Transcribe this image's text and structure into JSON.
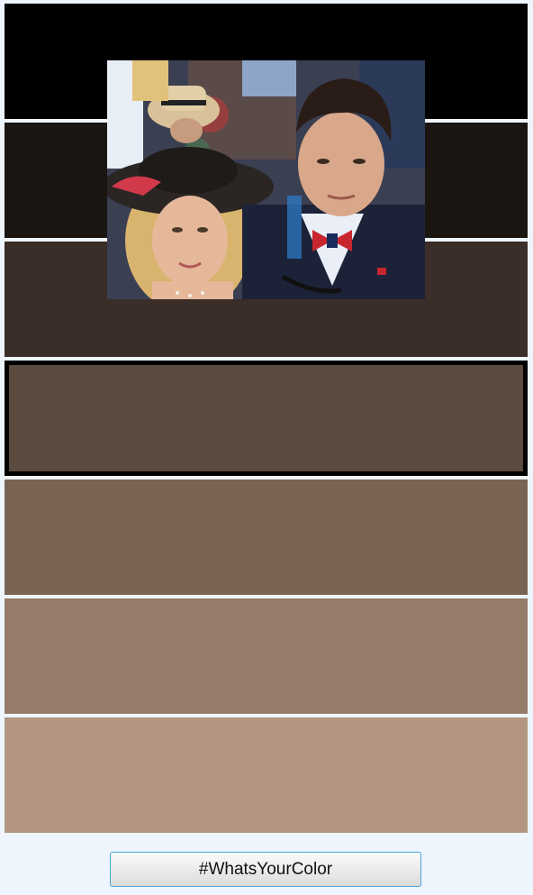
{
  "palette": {
    "swatches": [
      {
        "color": "#000000",
        "selected": false
      },
      {
        "color": "#1b1512",
        "selected": false
      },
      {
        "color": "#3b2e28",
        "selected": false
      },
      {
        "color": "#5b4a3e",
        "selected": true
      },
      {
        "color": "#7a6555",
        "selected": false
      },
      {
        "color": "#957b6a",
        "selected": false
      },
      {
        "color": "#b29681",
        "selected": false
      }
    ],
    "selected_border_color": "#000000"
  },
  "photo": {
    "subject": "selfie-photo"
  },
  "action_button": {
    "label": "#WhatsYourColor",
    "border_color": "#48a6d6"
  },
  "page_background": "#eef5fd"
}
